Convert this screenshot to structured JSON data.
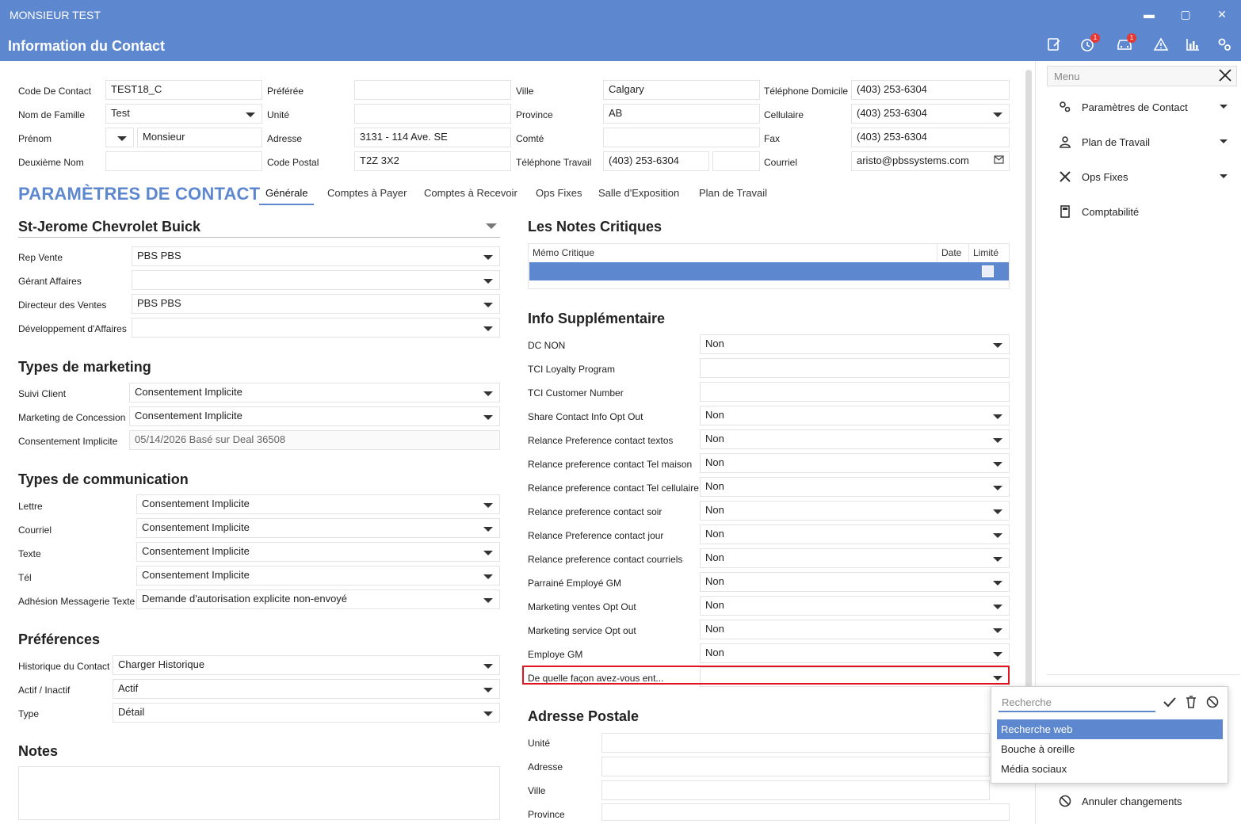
{
  "window": {
    "title": "MONSIEUR TEST",
    "minimize": "▬",
    "maximize": "▢",
    "close": "✕"
  },
  "header": {
    "title": "Information du Contact",
    "badge_history": "1",
    "badge_car": "1"
  },
  "contact": {
    "code_label": "Code De Contact",
    "code_value": "TEST18_C",
    "nom_label": "Nom de Famille",
    "nom_value": "Test",
    "prenom_label": "Prénom",
    "prenom_value": "Monsieur",
    "deuxieme_label": "Deuxième Nom",
    "deuxieme_value": "",
    "preferee_label": "Préférée",
    "preferee_value": "",
    "unite_label": "Unité",
    "unite_value": "",
    "adresse_label": "Adresse",
    "adresse_value": "3131 - 114 Ave. SE",
    "codepostal_label": "Code Postal",
    "codepostal_value": "T2Z 3X2",
    "ville_label": "Ville",
    "ville_value": "Calgary",
    "province_label": "Province",
    "province_value": "AB",
    "comte_label": "Comté",
    "comte_value": "",
    "teltravail_label": "Téléphone Travail",
    "teltravail_value": "(403) 253-6304",
    "teltravail_ext": "",
    "teldomicile_label": "Téléphone Domicile",
    "teldomicile_value": "(403) 253-6304",
    "cellulaire_label": "Cellulaire",
    "cellulaire_value": "(403) 253-6304",
    "fax_label": "Fax",
    "fax_value": "(403) 253-6304",
    "courriel_label": "Courriel",
    "courriel_value": "aristo@pbssystems.com"
  },
  "section_title": "PARAMÈTRES DE CONTACT",
  "tabs": [
    "Générale",
    "Comptes à Payer",
    "Comptes à Recevoir",
    "Ops Fixes",
    "Salle d'Exposition",
    "Plan de Travail"
  ],
  "dealer": {
    "name": "St-Jerome Chevrolet Buick",
    "fields": [
      {
        "label": "Rep Vente",
        "value": "PBS PBS"
      },
      {
        "label": "Gérant Affaires",
        "value": ""
      },
      {
        "label": "Directeur des Ventes",
        "value": "PBS PBS"
      },
      {
        "label": "Développement d'Affaires",
        "value": ""
      }
    ]
  },
  "marketing": {
    "title": "Types de marketing",
    "fields": [
      {
        "label": "Suivi Client",
        "value": "Consentement Implicite"
      },
      {
        "label": "Marketing de Concession",
        "value": "Consentement Implicite"
      },
      {
        "label": "Consentement Implicite",
        "value": "05/14/2026 Basé sur Deal 36508"
      }
    ]
  },
  "communication": {
    "title": "Types de communication",
    "fields": [
      {
        "label": "Lettre",
        "value": "Consentement Implicite"
      },
      {
        "label": "Courriel",
        "value": "Consentement Implicite"
      },
      {
        "label": "Texte",
        "value": "Consentement Implicite"
      },
      {
        "label": "Tél",
        "value": "Consentement Implicite"
      },
      {
        "label": "Adhésion Messagerie Texte",
        "value": "Demande d'autorisation explicite non-envoyé"
      }
    ]
  },
  "preferences": {
    "title": "Préférences",
    "fields": [
      {
        "label": "Historique du Contact",
        "value": "Charger Historique"
      },
      {
        "label": "Actif / Inactif",
        "value": "Actif"
      },
      {
        "label": "Type",
        "value": "Détail"
      }
    ]
  },
  "notes": {
    "title": "Notes"
  },
  "critical_notes": {
    "title": "Les Notes Critiques",
    "col_memo": "Mémo Critique",
    "col_date": "Date",
    "col_limite": "Limité"
  },
  "info_supp": {
    "title": "Info Supplémentaire",
    "fields": [
      {
        "label": "DC NON",
        "value": "Non"
      },
      {
        "label": "TCI Loyalty Program",
        "value": ""
      },
      {
        "label": "TCI Customer Number",
        "value": ""
      },
      {
        "label": "Share Contact Info Opt Out",
        "value": "Non"
      },
      {
        "label": "Relance Preference contact textos",
        "value": "Non"
      },
      {
        "label": "Relance preference contact Tel maison",
        "value": "Non"
      },
      {
        "label": "Relance preference contact Tel cellulaire",
        "value": "Non"
      },
      {
        "label": "Relance preference contact soir",
        "value": "Non"
      },
      {
        "label": "Relance Preference contact jour",
        "value": "Non"
      },
      {
        "label": "Relance preference contact courriels",
        "value": "Non"
      },
      {
        "label": "Parrainé Employé GM",
        "value": "Non"
      },
      {
        "label": "Marketing ventes Opt Out",
        "value": "Non"
      },
      {
        "label": "Marketing service Opt out",
        "value": "Non"
      },
      {
        "label": "Employe GM",
        "value": "Non"
      },
      {
        "label": "De quelle façon avez-vous ent...",
        "value": ""
      }
    ]
  },
  "adresse_postale": {
    "title": "Adresse Postale",
    "fields": [
      {
        "label": "Unité",
        "value": ""
      },
      {
        "label": "Adresse",
        "value": ""
      },
      {
        "label": "Ville",
        "value": ""
      },
      {
        "label": "Province",
        "value": ""
      }
    ]
  },
  "right_menu": {
    "search_placeholder": "Menu",
    "items": [
      {
        "label": "Paramètres de Contact",
        "icon": "gears-icon"
      },
      {
        "label": "Plan de Travail",
        "icon": "person-icon"
      },
      {
        "label": "Ops Fixes",
        "icon": "tools-icon"
      },
      {
        "label": "Comptabilité",
        "icon": "calculator-icon"
      }
    ],
    "cancel_label": "Annuler changements"
  },
  "popup": {
    "search_placeholder": "Recherche",
    "options": [
      "Recherche web",
      "Bouche à oreille",
      "Média sociaux"
    ]
  }
}
